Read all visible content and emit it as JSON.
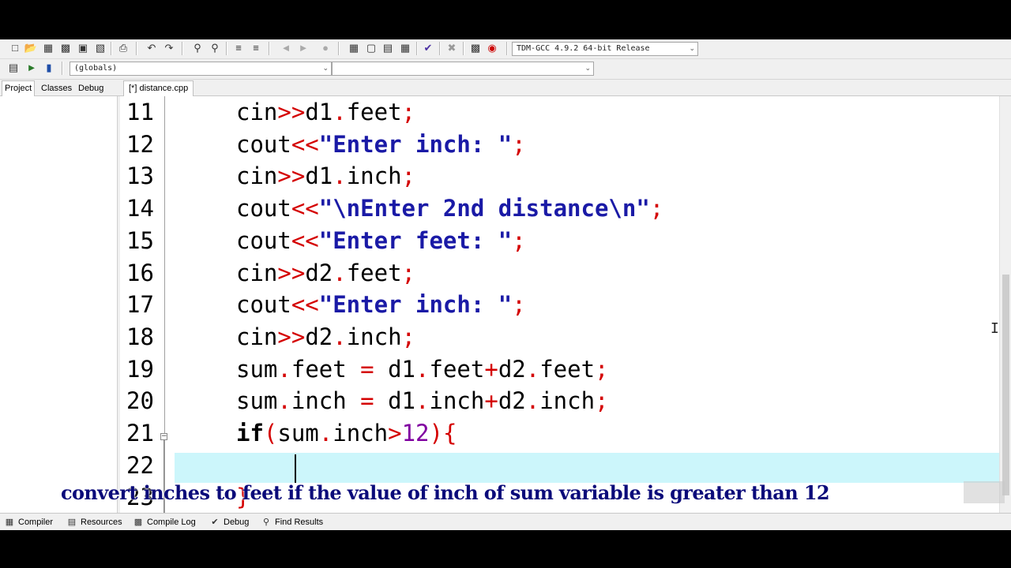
{
  "toolbar": {
    "compiler_select": "TDM-GCC 4.9.2 64-bit Release",
    "scope_select": "(globals)",
    "member_select": ""
  },
  "panel_tabs": [
    "Project",
    "Classes",
    "Debug"
  ],
  "file_tab": "[*] distance.cpp",
  "editor": {
    "lines": [
      {
        "n": "11",
        "html": "cin<span class='op'>&gt;&gt;</span>d1<span class='op'>.</span>feet<span class='op'>;</span>"
      },
      {
        "n": "12",
        "html": "cout<span class='op'>&lt;&lt;</span><span class='str'>\"Enter inch: \"</span><span class='op'>;</span>"
      },
      {
        "n": "13",
        "html": "cin<span class='op'>&gt;&gt;</span>d1<span class='op'>.</span>inch<span class='op'>;</span>"
      },
      {
        "n": "14",
        "html": "cout<span class='op'>&lt;&lt;</span><span class='str'>\"\\nEnter 2nd distance\\n\"</span><span class='op'>;</span>"
      },
      {
        "n": "15",
        "html": "cout<span class='op'>&lt;&lt;</span><span class='str'>\"Enter feet: \"</span><span class='op'>;</span>"
      },
      {
        "n": "16",
        "html": "cin<span class='op'>&gt;&gt;</span>d2<span class='op'>.</span>feet<span class='op'>;</span>"
      },
      {
        "n": "17",
        "html": "cout<span class='op'>&lt;&lt;</span><span class='str'>\"Enter inch: \"</span><span class='op'>;</span>"
      },
      {
        "n": "18",
        "html": "cin<span class='op'>&gt;&gt;</span>d2<span class='op'>.</span>inch<span class='op'>;</span>"
      },
      {
        "n": "19",
        "html": "sum<span class='op'>.</span>feet <span class='op'>=</span> d1<span class='op'>.</span>feet<span class='op'>+</span>d2<span class='op'>.</span>feet<span class='op'>;</span>"
      },
      {
        "n": "20",
        "html": "sum<span class='op'>.</span>inch <span class='op'>=</span> d1<span class='op'>.</span>inch<span class='op'>+</span>d2<span class='op'>.</span>inch<span class='op'>;</span>"
      },
      {
        "n": "21",
        "html": "<span class='kw'>if</span><span class='op'>(</span>sum<span class='op'>.</span>inch<span class='op'>&gt;</span><span class='num'>12</span><span class='op'>){</span>"
      },
      {
        "n": "22",
        "html": ""
      },
      {
        "n": "23",
        "html": "<span class='op'>}</span>"
      }
    ]
  },
  "caption": "convert inches to feet if the value of inch of sum variable is greater than 12",
  "bottom_tabs": [
    "Compiler",
    "Resources",
    "Compile Log",
    "Debug",
    "Find Results"
  ]
}
